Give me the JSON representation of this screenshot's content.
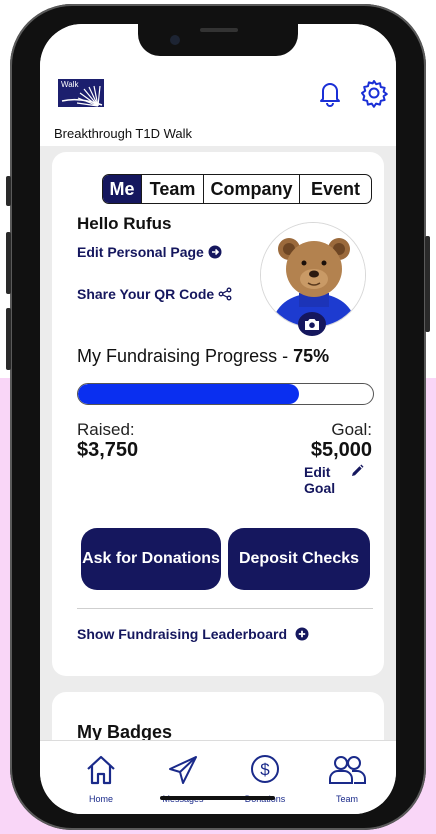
{
  "header": {
    "logo_text": "Walk",
    "org_name": "Breakthrough T1D Walk",
    "icons": [
      "bell-icon",
      "gear-icon"
    ]
  },
  "tabs": [
    {
      "label": "Me",
      "active": true
    },
    {
      "label": "Team",
      "active": false
    },
    {
      "label": "Company",
      "active": false
    },
    {
      "label": "Event",
      "active": false
    }
  ],
  "profile": {
    "greeting": "Hello Rufus",
    "edit_page": "Edit Personal Page",
    "share_qr": "Share Your QR Code"
  },
  "progress": {
    "title": "My Fundraising Progress - ",
    "percent_label": "75%",
    "percent": 75
  },
  "stats": {
    "raised_label": "Raised:",
    "raised_value": "$3,750",
    "goal_label": "Goal:",
    "goal_value": "$5,000",
    "edit_goal": "Edit Goal"
  },
  "actions": {
    "ask": "Ask for Donations",
    "deposit": "Deposit Checks"
  },
  "leaderboard": "Show Fundraising Leaderboard",
  "badges": {
    "title": "My Badges"
  },
  "nav": [
    {
      "label": "Home",
      "icon": "home-icon"
    },
    {
      "label": "Messages",
      "icon": "send-icon"
    },
    {
      "label": "Donations",
      "icon": "dollar-icon"
    },
    {
      "label": "Team",
      "icon": "team-icon"
    }
  ],
  "colors": {
    "brand_navy": "#15175e",
    "progress_blue": "#0a2ff0",
    "background_pink": "#f9d6f7"
  }
}
